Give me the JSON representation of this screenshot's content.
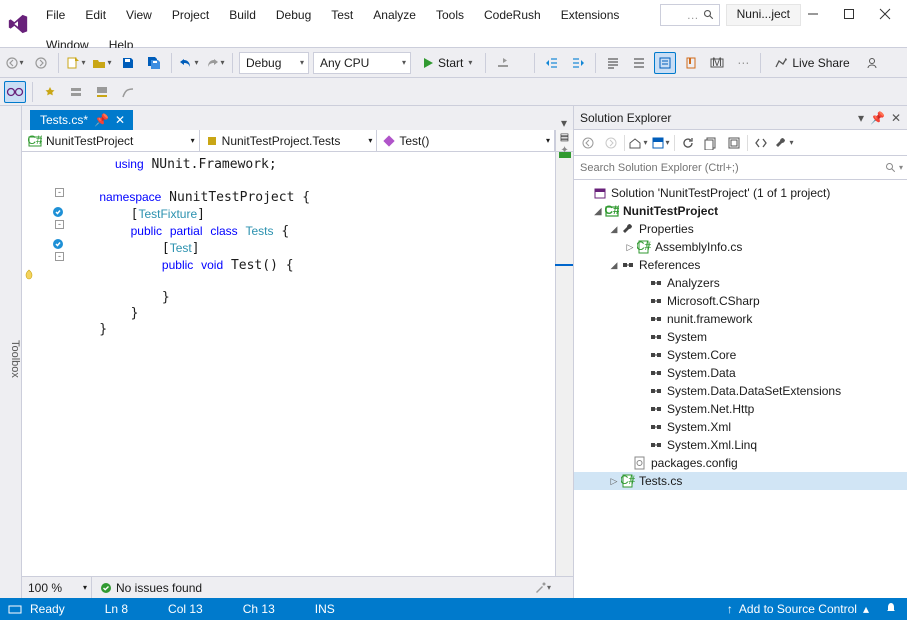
{
  "menu": [
    "File",
    "Edit",
    "View",
    "Project",
    "Build",
    "Debug",
    "Test",
    "Analyze",
    "Tools",
    "CodeRush",
    "Extensions",
    "Window",
    "Help"
  ],
  "title_caption": "Nuni...ject",
  "toolbar": {
    "config": "Debug",
    "platform": "Any CPU",
    "start": "Start",
    "liveshare": "Live Share"
  },
  "sidebar_rail": "Toolbox",
  "editor": {
    "tab": "Tests.cs*",
    "nav": {
      "project": "NunitTestProject",
      "namespace": "NunitTestProject.Tests",
      "method": "Test()"
    },
    "code": {
      "l1": "using NUnit.Framework;",
      "l2": "namespace NunitTestProject {",
      "l3": "    [TestFixture]",
      "l4": "    public partial class Tests {",
      "l5": "        [Test]",
      "l6": "        public void Test() {",
      "l7": "        }",
      "l8": "    }",
      "l9": "}"
    },
    "zoom": "100 %",
    "issues": "No issues found"
  },
  "explorer": {
    "title": "Solution Explorer",
    "search_placeholder": "Search Solution Explorer (Ctrl+;)",
    "solution": "Solution 'NunitTestProject' (1 of 1 project)",
    "project": "NunitTestProject",
    "properties": "Properties",
    "assemblyinfo": "AssemblyInfo.cs",
    "references": "References",
    "refs": [
      "Analyzers",
      "Microsoft.CSharp",
      "nunit.framework",
      "System",
      "System.Core",
      "System.Data",
      "System.Data.DataSetExtensions",
      "System.Net.Http",
      "System.Xml",
      "System.Xml.Linq"
    ],
    "packages": "packages.config",
    "tests": "Tests.cs"
  },
  "status": {
    "ready": "Ready",
    "ln": "Ln 8",
    "col": "Col 13",
    "ch": "Ch 13",
    "ins": "INS",
    "src": "Add to Source Control"
  }
}
